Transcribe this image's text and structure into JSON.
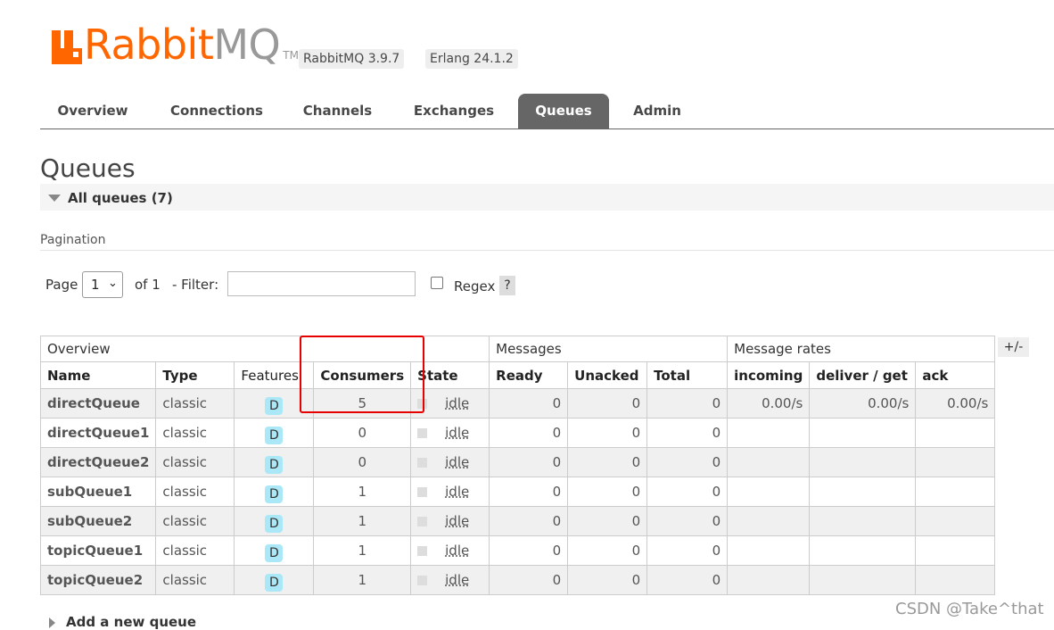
{
  "header": {
    "logo_text_a": "Rabbit",
    "logo_text_b": "MQ",
    "logo_tm": "TM",
    "rabbitmq_version": "RabbitMQ 3.9.7",
    "erlang_version": "Erlang 24.1.2"
  },
  "nav": {
    "tabs": [
      {
        "label": "Overview",
        "active": false
      },
      {
        "label": "Connections",
        "active": false
      },
      {
        "label": "Channels",
        "active": false
      },
      {
        "label": "Exchanges",
        "active": false
      },
      {
        "label": "Queues",
        "active": true
      },
      {
        "label": "Admin",
        "active": false
      }
    ]
  },
  "page": {
    "title": "Queues",
    "section_label": "All queues (7)",
    "pagination_label": "Pagination"
  },
  "pagination": {
    "page_label": "Page",
    "page_value": "1",
    "of_label": "of 1",
    "filter_label": "- Filter:",
    "filter_value": "",
    "regex_label": "Regex",
    "regex_checked": false,
    "help_label": "?"
  },
  "table": {
    "group_headers": [
      "Overview",
      "Messages",
      "Message rates"
    ],
    "columns": [
      "Name",
      "Type",
      "Features",
      "Consumers",
      "State",
      "Ready",
      "Unacked",
      "Total",
      "incoming",
      "deliver / get",
      "ack"
    ],
    "plus_minus": "+/-",
    "rows": [
      {
        "name": "directQueue",
        "type": "classic",
        "feature": "D",
        "consumers": "5",
        "state": "idle",
        "ready": "0",
        "unacked": "0",
        "total": "0",
        "incoming": "0.00/s",
        "deliver_get": "0.00/s",
        "ack": "0.00/s"
      },
      {
        "name": "directQueue1",
        "type": "classic",
        "feature": "D",
        "consumers": "0",
        "state": "idle",
        "ready": "0",
        "unacked": "0",
        "total": "0",
        "incoming": "",
        "deliver_get": "",
        "ack": ""
      },
      {
        "name": "directQueue2",
        "type": "classic",
        "feature": "D",
        "consumers": "0",
        "state": "idle",
        "ready": "0",
        "unacked": "0",
        "total": "0",
        "incoming": "",
        "deliver_get": "",
        "ack": ""
      },
      {
        "name": "subQueue1",
        "type": "classic",
        "feature": "D",
        "consumers": "1",
        "state": "idle",
        "ready": "0",
        "unacked": "0",
        "total": "0",
        "incoming": "",
        "deliver_get": "",
        "ack": ""
      },
      {
        "name": "subQueue2",
        "type": "classic",
        "feature": "D",
        "consumers": "1",
        "state": "idle",
        "ready": "0",
        "unacked": "0",
        "total": "0",
        "incoming": "",
        "deliver_get": "",
        "ack": ""
      },
      {
        "name": "topicQueue1",
        "type": "classic",
        "feature": "D",
        "consumers": "1",
        "state": "idle",
        "ready": "0",
        "unacked": "0",
        "total": "0",
        "incoming": "",
        "deliver_get": "",
        "ack": ""
      },
      {
        "name": "topicQueue2",
        "type": "classic",
        "feature": "D",
        "consumers": "1",
        "state": "idle",
        "ready": "0",
        "unacked": "0",
        "total": "0",
        "incoming": "",
        "deliver_get": "",
        "ack": ""
      }
    ]
  },
  "footer": {
    "add_queue_label": "Add a new queue",
    "watermark": "CSDN @Take^that"
  },
  "colors": {
    "brand_orange": "#ff6600",
    "active_tab": "#666666",
    "durable_badge": "#aae8f7",
    "highlight_red": "#e60000"
  }
}
